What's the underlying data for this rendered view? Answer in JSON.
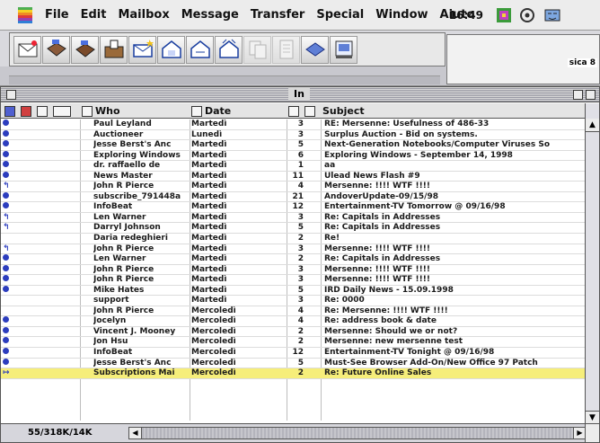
{
  "menubar": {
    "items": [
      "File",
      "Edit",
      "Mailbox",
      "Message",
      "Transfer",
      "Special",
      "Window",
      "Aiuto"
    ],
    "clock": "16:49"
  },
  "toolbar": {
    "buttons": [
      {
        "icon": "new-message-icon"
      },
      {
        "icon": "inbox-icon"
      },
      {
        "icon": "outbox-icon"
      },
      {
        "icon": "check-mail-icon"
      },
      {
        "icon": "reply-icon"
      },
      {
        "icon": "reply-all-icon"
      },
      {
        "icon": "forward-icon"
      },
      {
        "icon": "redirect-icon"
      },
      {
        "icon": "copy-icon",
        "disabled": true
      },
      {
        "icon": "paste-icon",
        "disabled": true
      },
      {
        "icon": "trash-icon"
      },
      {
        "icon": "print-icon"
      }
    ]
  },
  "background_window": {
    "caption": "sica 8"
  },
  "window": {
    "title": "In",
    "columns": {
      "who": "Who",
      "date": "Date",
      "subject": "Subject"
    },
    "messages": [
      {
        "mark": "dot",
        "who": "Paul Leyland",
        "date": "Martedì",
        "size": "3",
        "subject": "RE: Mersenne: Usefulness of 486-33"
      },
      {
        "mark": "dot",
        "who": "Auctioneer",
        "date": "Lunedì",
        "size": "3",
        "subject": "Surplus Auction - Bid on systems."
      },
      {
        "mark": "dot",
        "who": "Jesse Berst's Anc",
        "date": "Martedì",
        "size": "5",
        "subject": "Next-Generation Notebooks/Computer Viruses So"
      },
      {
        "mark": "dot",
        "who": "Exploring Windows",
        "date": "Martedì",
        "size": "6",
        "subject": "Exploring Windows - September 14, 1998"
      },
      {
        "mark": "dot",
        "who": "dr. raffaello de",
        "date": "Martedì",
        "size": "1",
        "subject": "aa"
      },
      {
        "mark": "dot",
        "who": "News Master",
        "date": "Martedì",
        "size": "11",
        "subject": "Ulead News Flash #9"
      },
      {
        "mark": "reply",
        "who": "John R Pierce",
        "date": "Martedì",
        "size": "4",
        "subject": "Mersenne: !!!! WTF !!!!"
      },
      {
        "mark": "dot",
        "who": "subscribe_791448a",
        "date": "Martedì",
        "size": "21",
        "subject": "AndoverUpdate-09/15/98"
      },
      {
        "mark": "dot",
        "who": "InfoBeat",
        "date": "Martedì",
        "size": "12",
        "subject": "Entertainment-TV Tomorrow @ 09/16/98"
      },
      {
        "mark": "reply",
        "who": "Len Warner",
        "date": "Martedì",
        "size": "3",
        "subject": "Re: Capitals in Addresses"
      },
      {
        "mark": "reply",
        "who": "Darryl Johnson",
        "date": "Martedì",
        "size": "5",
        "subject": "Re: Capitals in Addresses"
      },
      {
        "mark": "none",
        "who": "Daria redeghieri",
        "date": "Martedì",
        "size": "2",
        "subject": "Re!"
      },
      {
        "mark": "reply",
        "who": "John R Pierce",
        "date": "Martedì",
        "size": "3",
        "subject": "Mersenne: !!!! WTF !!!!"
      },
      {
        "mark": "dot",
        "who": "Len Warner",
        "date": "Martedì",
        "size": "2",
        "subject": "Re: Capitals in Addresses"
      },
      {
        "mark": "dot",
        "who": "John R Pierce",
        "date": "Martedì",
        "size": "3",
        "subject": "Mersenne: !!!! WTF !!!!"
      },
      {
        "mark": "dot",
        "who": "John R Pierce",
        "date": "Martedì",
        "size": "3",
        "subject": "Mersenne: !!!! WTF !!!!"
      },
      {
        "mark": "dot",
        "who": "Mike Hates",
        "date": "Martedì",
        "size": "5",
        "subject": "IRD Daily News - 15.09.1998"
      },
      {
        "mark": "none",
        "who": "support",
        "date": "Martedì",
        "size": "3",
        "subject": "Re: 0000"
      },
      {
        "mark": "none",
        "who": "John R Pierce",
        "date": "Mercoledì",
        "size": "4",
        "subject": "Re: Mersenne: !!!! WTF !!!!"
      },
      {
        "mark": "dot",
        "who": "Jocelyn",
        "date": "Mercoledì",
        "size": "4",
        "subject": "Re: address book & date"
      },
      {
        "mark": "dot",
        "who": "Vincent J. Mooney",
        "date": "Mercoledì",
        "size": "2",
        "subject": "Mersenne: Should we or not?"
      },
      {
        "mark": "dot",
        "who": "Jon Hsu",
        "date": "Mercoledì",
        "size": "2",
        "subject": "Mersenne: new mersenne test"
      },
      {
        "mark": "dot",
        "who": "InfoBeat",
        "date": "Mercoledì",
        "size": "12",
        "subject": "Entertainment-TV Tonight @ 09/16/98"
      },
      {
        "mark": "dot",
        "who": "Jesse Berst's Anc",
        "date": "Mercoledì",
        "size": "5",
        "subject": "Must-See Browser Add-On/New Office 97 Patch"
      },
      {
        "mark": "forward",
        "who": "Subscriptions Mai",
        "date": "Mercoledì",
        "size": "2",
        "subject": "Re: Future Online Sales",
        "selected": true
      }
    ]
  },
  "status": {
    "count": "55/318K/14K"
  },
  "colors": {
    "unread_dot": "#2c3dbe",
    "selection": "#f6ee7a"
  }
}
